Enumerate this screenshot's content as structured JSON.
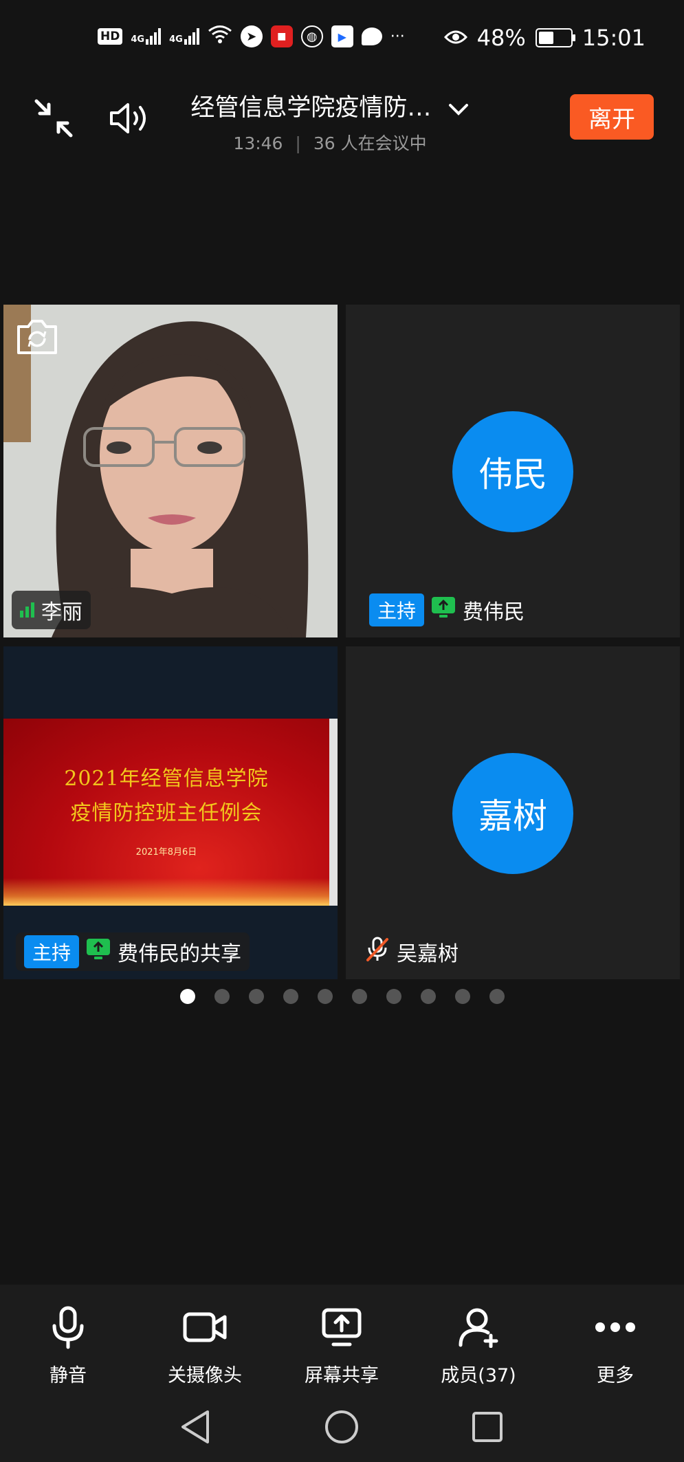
{
  "status_bar": {
    "hd_label": "HD",
    "network_labels": [
      "4G",
      "4G"
    ],
    "more_label": "···",
    "battery_percent": "48%",
    "battery_level": 0.48,
    "time": "15:01"
  },
  "header": {
    "title": "经管信息学院疫情防…",
    "elapsed": "13:46",
    "attendees": "36 人在会议中",
    "leave_label": "离开"
  },
  "tiles": [
    {
      "name": "李丽",
      "type": "video",
      "signal": "good"
    },
    {
      "name": "费伟民",
      "avatar_text": "伟民",
      "host_label": "主持",
      "sharing": true
    },
    {
      "name": "费伟民的共享",
      "host_label": "主持",
      "slide": {
        "title_line1": "2021年经管信息学院",
        "title_line2": "疫情防控班主任例会",
        "date": "2021年8月6日"
      }
    },
    {
      "name": "吴嘉树",
      "avatar_text": "嘉树",
      "muted": true
    }
  ],
  "pager": {
    "pages": 10,
    "active": 1
  },
  "toolbar": {
    "mute_label": "静音",
    "camera_label": "关摄像头",
    "share_label": "屏幕共享",
    "members_label": "成员(37)",
    "more_label": "更多"
  },
  "colors": {
    "background": "#141414",
    "accent_blue": "#0a8cf0",
    "leave_orange": "#fa5a23",
    "share_green": "#1fbf4f",
    "slide_gold": "#f2c81d"
  }
}
